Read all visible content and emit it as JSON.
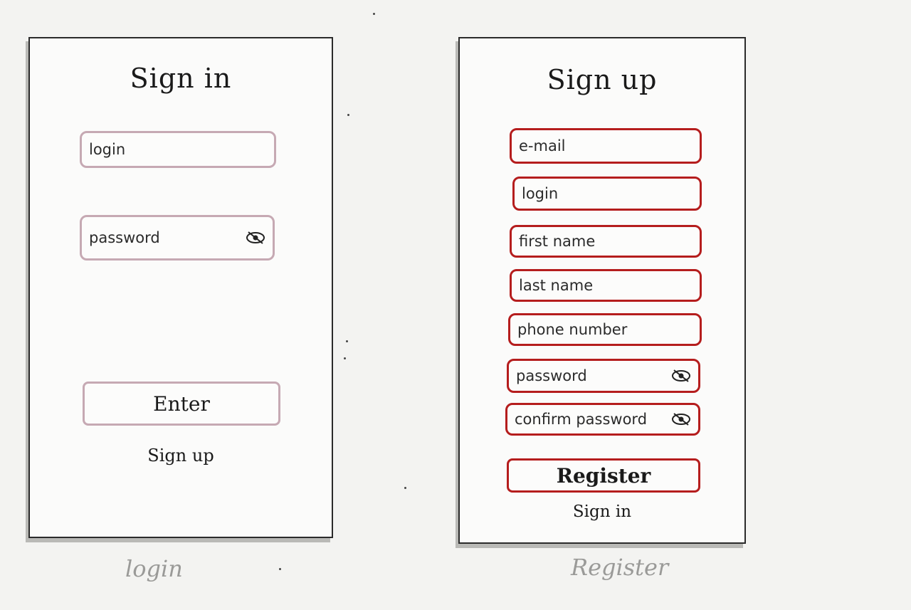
{
  "login_screen": {
    "title": "Sign in",
    "login_placeholder": "login",
    "password_placeholder": "password",
    "enter_label": "Enter",
    "signup_link": "Sign up",
    "caption": "login"
  },
  "register_screen": {
    "title": "Sign up",
    "fields": [
      "e-mail",
      "login",
      "first name",
      "last name",
      "phone number",
      "password",
      "confirm password"
    ],
    "register_label": "Register",
    "signin_link": "Sign in",
    "caption": "Register"
  },
  "colors": {
    "login_border": "#c6a9b3",
    "register_border": "#b51d1d"
  },
  "icons": {
    "password_toggle": "eye-slash-icon"
  }
}
